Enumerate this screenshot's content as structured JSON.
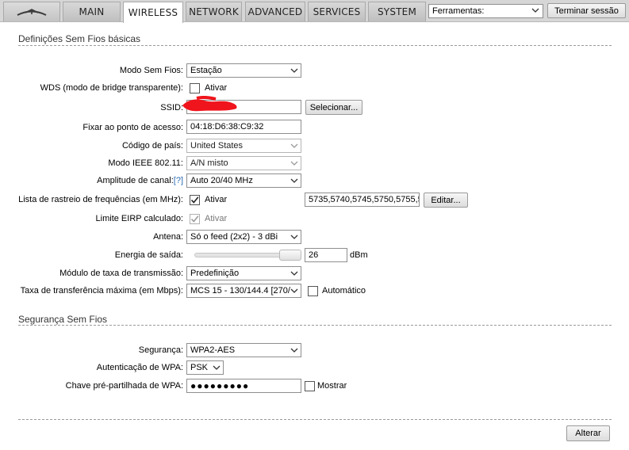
{
  "nav": {
    "tabs": [
      "MAIN",
      "WIRELESS",
      "NETWORK",
      "ADVANCED",
      "SERVICES",
      "SYSTEM"
    ],
    "active_tab": "WIRELESS",
    "tools_value": "Ferramentas:",
    "logout_label": "Terminar sessão"
  },
  "basic": {
    "title": "Definições Sem Fios básicas",
    "wireless_mode": {
      "label": "Modo Sem Fios:",
      "value": "Estação"
    },
    "wds": {
      "label": "WDS (modo de bridge transparente):",
      "check_label": "Ativar"
    },
    "ssid": {
      "label": "SSID:",
      "value": "",
      "select_label": "Selecionar..."
    },
    "lock_ap": {
      "label": "Fixar ao ponto de acesso:",
      "value": "04:18:D6:38:C9:32"
    },
    "country": {
      "label": "Código de país:",
      "value": "United States"
    },
    "ieee_mode": {
      "label": "Modo IEEE 802.11:",
      "value": "A/N misto"
    },
    "channel_width": {
      "label": "Amplitude de canal:",
      "help": "[?]",
      "value": "Auto 20/40 MHz"
    },
    "scan_list": {
      "label": "Lista de rastreio de frequências (em MHz):",
      "check_label": "Ativar",
      "value": "5735,5740,5745,5750,5755,5",
      "edit_label": "Editar..."
    },
    "eirp": {
      "label": "Limite EIRP calculado:",
      "check_label": "Ativar"
    },
    "antenna": {
      "label": "Antena:",
      "value": "Só o feed (2x2) - 3 dBi"
    },
    "output_power": {
      "label": "Energia de saída:",
      "value": "26",
      "unit": "dBm"
    },
    "rate_module": {
      "label": "Módulo de taxa de transmissão:",
      "value": "Predefinição"
    },
    "max_rate": {
      "label": "Taxa de transferência máxima (em Mbps):",
      "value": "MCS 15 - 130/144.4 [270/",
      "check_label": "Automático"
    }
  },
  "security": {
    "title": "Segurança Sem Fios",
    "security": {
      "label": "Segurança:",
      "value": "WPA2-AES"
    },
    "wpa_auth": {
      "label": "Autenticação de WPA:",
      "value": "PSK"
    },
    "psk": {
      "label": "Chave pré-partilhada de WPA:",
      "value": "●●●●●●●●●",
      "check_label": "Mostrar"
    }
  },
  "footer": {
    "apply_label": "Alterar"
  }
}
